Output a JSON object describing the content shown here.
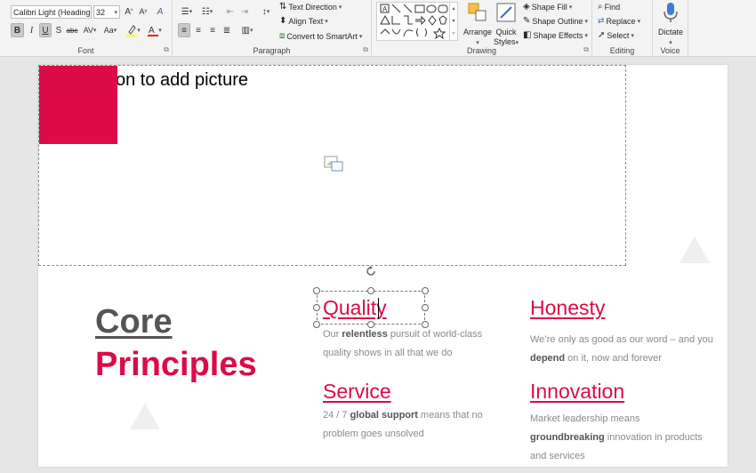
{
  "ribbon": {
    "font": {
      "label": "Font",
      "font_name": "Calibri Light (Heading",
      "font_size": "32",
      "grow": "A",
      "shrink": "A",
      "clear": "A",
      "bold": "B",
      "italic": "I",
      "underline": "U",
      "strike": "S",
      "shadow": "abc",
      "spacing": "AV",
      "case": "Aa",
      "highlight_color": "#ffff00",
      "font_color": "#ff0000"
    },
    "paragraph": {
      "label": "Paragraph",
      "text_direction": "Text Direction",
      "align_text": "Align Text",
      "convert_smartart": "Convert to SmartArt"
    },
    "drawing": {
      "label": "Drawing",
      "arrange": "Arrange",
      "quick_styles_1": "Quick",
      "quick_styles_2": "Styles",
      "shape_fill": "Shape Fill",
      "shape_outline": "Shape Outline",
      "shape_effects": "Shape Effects"
    },
    "editing": {
      "label": "Editing",
      "find": "Find",
      "replace": "Replace",
      "select": "Select"
    },
    "voice": {
      "label": "Voice",
      "dictate": "Dictate"
    }
  },
  "slide": {
    "picture_placeholder": "on to add picture",
    "heading_line1": "Core",
    "heading_line2": "Principles",
    "principles": [
      {
        "title": "Quality",
        "body_pre": "Our ",
        "body_bold": "relentless",
        "body_post": " pursuit of world-class quality shows in all that we do"
      },
      {
        "title": "Honesty",
        "body_pre": "We’re only as good as our word – and you ",
        "body_bold": "depend",
        "body_post": " on it, now and forever"
      },
      {
        "title": "Service",
        "body_pre": "24 / 7 ",
        "body_bold": "global support",
        "body_post": " means that no problem goes unsolved"
      },
      {
        "title": "Innovation",
        "body_pre": "Market leadership means ",
        "body_bold": "groundbreaking",
        "body_post": " innovation in products and services"
      }
    ]
  },
  "colors": {
    "accent": "#dc0b47",
    "heading_gray": "#555555",
    "body_gray": "#8a8a8a"
  }
}
